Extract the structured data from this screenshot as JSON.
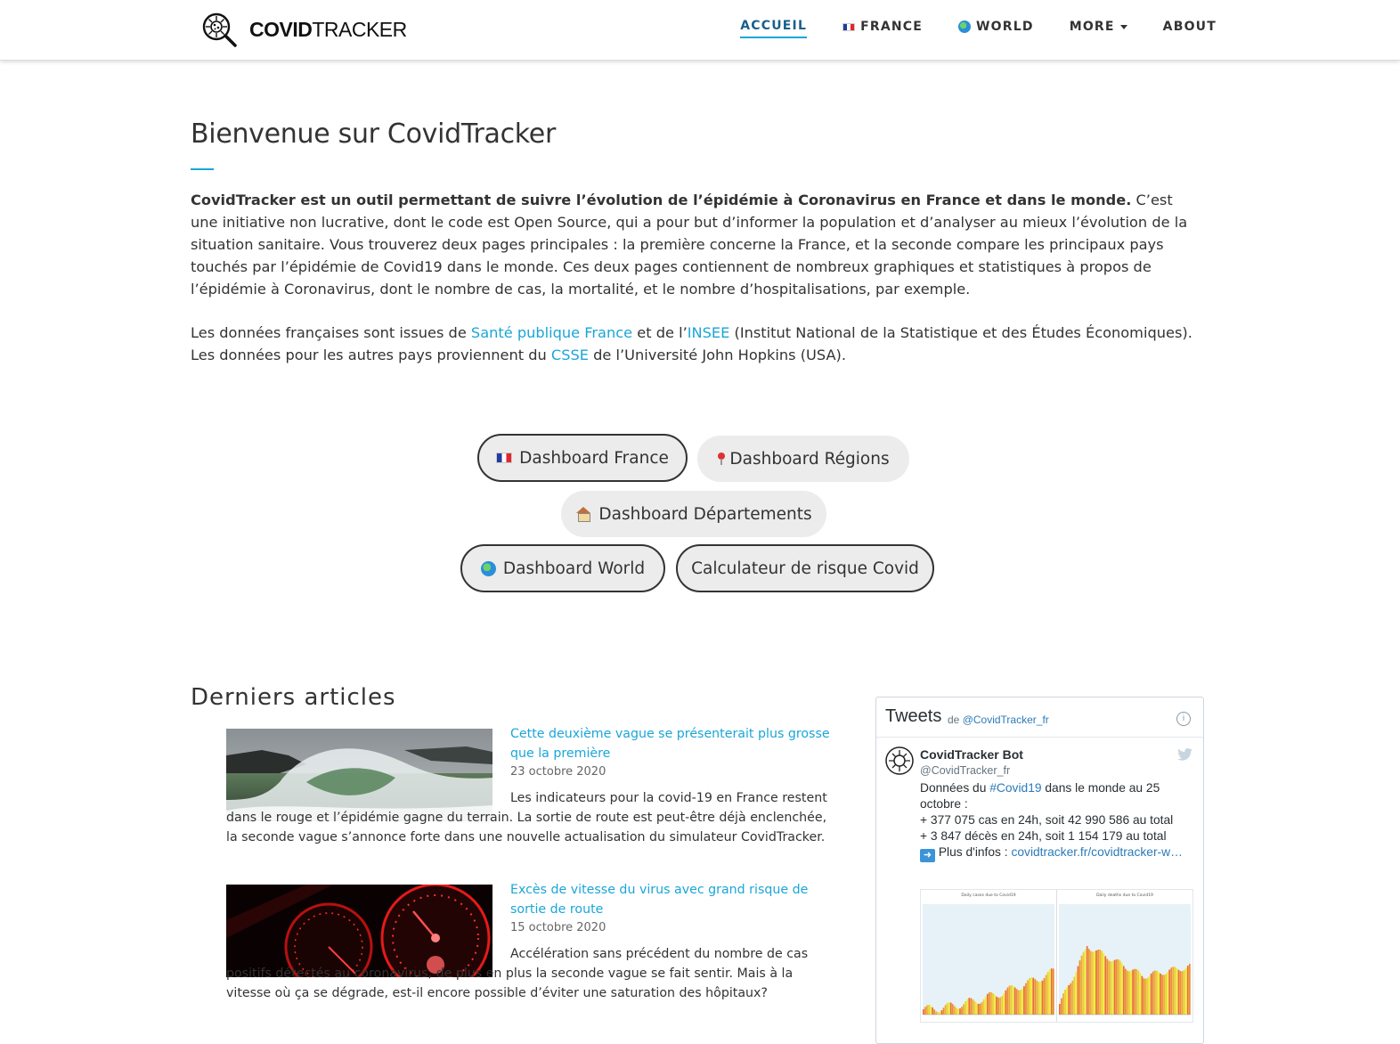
{
  "nav": {
    "brand_bold": "COVID",
    "brand_thin": "TRACKER",
    "links": [
      {
        "label": "ACCUEIL"
      },
      {
        "label": "FRANCE"
      },
      {
        "label": "WORLD"
      },
      {
        "label": "MORE"
      },
      {
        "label": "ABOUT"
      }
    ]
  },
  "intro": {
    "title": "Bienvenue sur CovidTracker",
    "p1_bold": "CovidTracker est un outil permettant de suivre l’évolution de l’épidémie à Coronavirus en France et dans le monde.",
    "p1_rest": " C’est une initiative non lucrative, dont le code est Open Source, qui a pour but d’informer la population et d’analyser au mieux l’évolution de la situation sanitaire. Vous trouverez deux pages principales : la première concerne la France, et la seconde compare les principaux pays touchés par l’épidémie de Covid19 dans le monde. Ces deux pages contiennent de nombreux graphiques et statistiques à propos de l’épidémie à Coronavirus, dont le nombre de cas, la mortalité, et le nombre d’hospitalisations, par exemple.",
    "p2_a": "Les données françaises sont issues de ",
    "p2_link1": "Santé publique France",
    "p2_b": " et de l’",
    "p2_link2": "INSEE",
    "p2_c": " (Institut National de la Statistique et des Études Économiques). Les données pour les autres pays proviennent du ",
    "p2_link3": "CSSE",
    "p2_d": " de l’Université John Hopkins (USA)."
  },
  "dashboards": {
    "france": "Dashboard France",
    "regions": "Dashboard Régions",
    "departements": "Dashboard Départements",
    "world": "Dashboard World",
    "risk": "Calculateur de risque Covid"
  },
  "articles": {
    "section_title": "Derniers articles",
    "items": [
      {
        "title": "Cette deuxième vague se présenterait plus grosse que la première",
        "date": "23 octobre 2020",
        "excerpt": "Les indicateurs pour la covid-19 en France restent dans le rouge et l’épidémie gagne du terrain. La sortie de route est peut-être déjà enclenchée, la seconde vague s’annonce forte dans une nouvelle actualisation du simulateur CovidTracker."
      },
      {
        "title": "Excès de vitesse du virus avec grand risque de sortie de route",
        "date": "15 octobre 2020",
        "excerpt": "Accélération sans précédent du nombre de cas positifs détectés au coronavirus, de plus en plus la seconde vague se fait sentir. Mais à la vitesse où ça se dégrade, est-il encore possible d’éviter une saturation des hôpitaux?"
      }
    ]
  },
  "tweets": {
    "title": "Tweets",
    "by_prefix": "de ",
    "by_handle": "@CovidTracker_fr",
    "author_name": "CovidTracker Bot",
    "author_handle": "@CovidTracker_fr",
    "line1_a": "Données du ",
    "line1_tag": "#Covid19",
    "line1_b": " dans le monde au 25 octobre :",
    "line2": "+ 377 075 cas en 24h, soit 42 990 586 au total",
    "line3": "+ 3 847 décès en 24h, soit 1 154 179 au total",
    "line4_a": " Plus d'infos : ",
    "line4_link": "covidtracker.fr/covidtracker-w…",
    "chart_left_title": "Daily cases due to Covid19",
    "chart_right_title": "Daily deaths due to Covid19"
  },
  "colors": {
    "accent": "#1aa6d8",
    "text": "#333333",
    "button_bg": "#ececec",
    "twitter_link": "#2b7bb9"
  }
}
